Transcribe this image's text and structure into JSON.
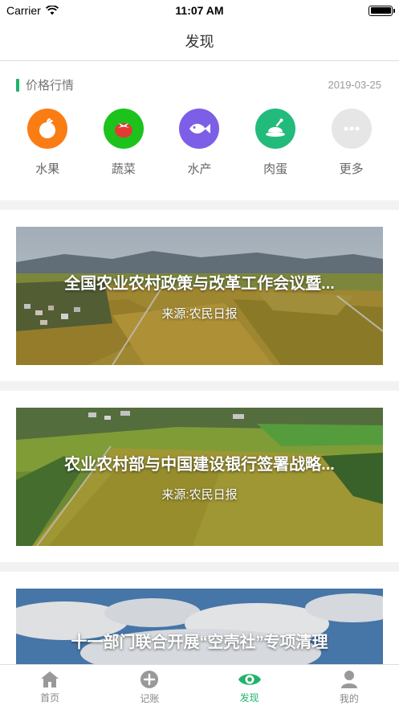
{
  "status_bar": {
    "carrier": "Carrier",
    "time": "11:07 AM"
  },
  "nav": {
    "title": "发现"
  },
  "price_section": {
    "title": "价格行情",
    "date": "2019-03-25",
    "accent_color": "#21b36b",
    "categories": [
      {
        "label": "水果",
        "icon": "fruit-icon",
        "color": "#fa7d14"
      },
      {
        "label": "蔬菜",
        "icon": "vegetable-icon",
        "color": "#1dc21d"
      },
      {
        "label": "水产",
        "icon": "fish-icon",
        "color": "#7d5ee6"
      },
      {
        "label": "肉蛋",
        "icon": "meat-icon",
        "color": "#23bb7c"
      },
      {
        "label": "更多",
        "icon": "more-icon",
        "color": "#e6e6e6"
      }
    ]
  },
  "news": [
    {
      "title": "全国农业农村政策与改革工作会议暨...",
      "source": "来源:农民日报"
    },
    {
      "title": "农业农村部与中国建设银行签署战略...",
      "source": "来源:农民日报"
    },
    {
      "title": "十一部门联合开展“空壳社”专项清理",
      "source": ""
    }
  ],
  "tab_bar": {
    "active_color": "#21b36b",
    "tabs": [
      {
        "label": "首页",
        "icon": "home-icon"
      },
      {
        "label": "记账",
        "icon": "plus-icon"
      },
      {
        "label": "发现",
        "icon": "eye-icon",
        "active": true
      },
      {
        "label": "我的",
        "icon": "profile-icon"
      }
    ]
  }
}
